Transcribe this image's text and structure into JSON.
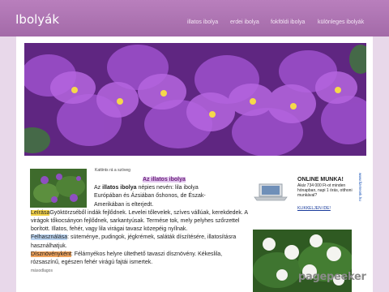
{
  "header": {
    "site_title": "Ibolyák",
    "nav": [
      "illatos ibolya",
      "erdei ibolya",
      "fokföldi ibolya",
      "különleges ibolyák"
    ]
  },
  "main": {
    "caption": "Kattints rá a szöveg",
    "heading": "Az illatos ibolya",
    "intro_prefix": "Az",
    "intro_bold": "illatos ibolya",
    "intro_rest": "népies nevén: lila ibolya",
    "intro_line2": "Európában és Ázsiában őshonos, de Észak-",
    "intro_line3": "Amerikában is elterjedt.",
    "label_description": "Leírása",
    "description": "Gyöktörzséből indák fejlődnek. Levelei tőlevelek, szíves vállúak, kerekdedek. A virágok tőkocsányon fejlődnek, sarkantyúsak. Termése tok, mely pelyhes szőrzettel borított. Illatos, fehér, vagy lila virágai tavasz közepéig nyílnak.",
    "label_usage": "Felhasználása",
    "usage": "süteménye, pudingok, jégkrémek, saláták díszítésére, illatosításra használhatjuk.",
    "label_ornamental": "Dísznövényként",
    "ornamental": "Félárnyékos helyre ültethető tavaszi dísznövény. Kékeslila, rózsaszínű, egészen fehér virágú fajtái ismertek.",
    "trailing": "másodlagos"
  },
  "ad": {
    "title": "ONLINE MUNKA!",
    "body": "Akár 734 000 Ft-ot minden hónapban, napi 1 órás, otthoni munkával?",
    "link": "KLIKKELJEN IDE!",
    "side_url": "www.fizetesek.hu"
  },
  "watermark": "pagepeeker"
}
